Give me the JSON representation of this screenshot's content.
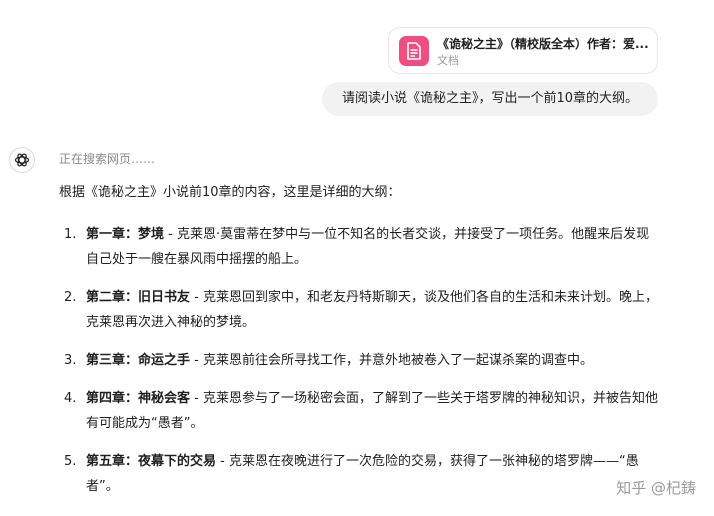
{
  "attachment": {
    "title": "《诡秘之主》（精校版全本）作者：爱...",
    "type_label": "文档",
    "icon": "document-icon",
    "accent_color": "#f04d82"
  },
  "user_message": "请阅读小说《诡秘之主》，写出一个前10章的大纲。",
  "assistant": {
    "avatar_icon": "chatgpt-logo-icon",
    "status": "正在搜索网页……",
    "intro": "根据《诡秘之主》小说前10章的内容，这里是详细的大纲：",
    "outline": [
      {
        "number": "1.",
        "chapter": "第一章：梦境",
        "summary": " - 克莱恩·莫雷蒂在梦中与一位不知名的长者交谈，并接受了一项任务。他醒来后发现自己处于一艘在暴风雨中摇摆的船上。"
      },
      {
        "number": "2.",
        "chapter": "第二章：旧日书友",
        "summary": " - 克莱恩回到家中，和老友丹特斯聊天，谈及他们各自的生活和未来计划。晚上，克莱恩再次进入神秘的梦境。"
      },
      {
        "number": "3.",
        "chapter": "第三章：命运之手",
        "summary": " - 克莱恩前往会所寻找工作，并意外地被卷入了一起谋杀案的调查中。"
      },
      {
        "number": "4.",
        "chapter": "第四章：神秘会客",
        "summary": " - 克莱恩参与了一场秘密会面，了解到了一些关于塔罗牌的神秘知识，并被告知他有可能成为“愚者”。"
      },
      {
        "number": "5.",
        "chapter": "第五章：夜幕下的交易",
        "summary": " - 克莱恩在夜晚进行了一次危险的交易，获得了一张神秘的塔罗牌——“愚者”。"
      }
    ]
  },
  "watermark": "知乎 @杞鋳"
}
